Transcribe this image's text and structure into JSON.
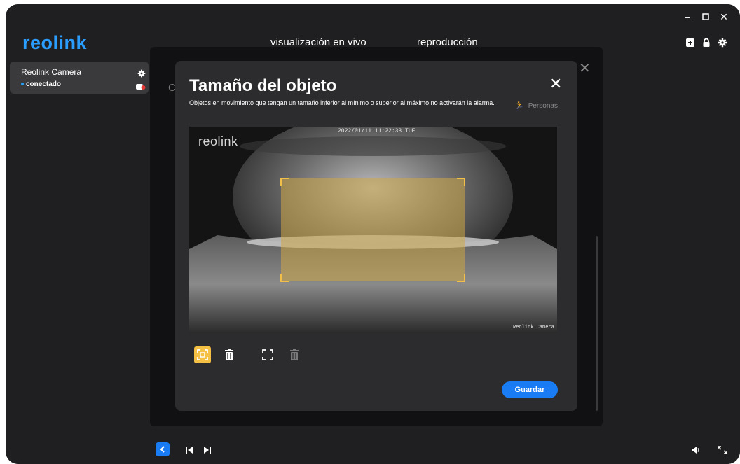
{
  "app": {
    "logo": "reolink",
    "nav_tabs": [
      "visualización en vivo",
      "reproducción"
    ],
    "window_controls": [
      "minimize-icon",
      "maximize-icon",
      "close-icon"
    ],
    "top_icons": [
      "add-device-icon",
      "lock-icon",
      "gear-icon"
    ],
    "accent_color": "#1a7cf5"
  },
  "sidebar": {
    "camera": {
      "name": "Reolink Camera",
      "status": "conectado"
    }
  },
  "settings_panel": {
    "partial_heading": "C"
  },
  "modal": {
    "title": "Tamaño del objeto",
    "description": "Objetos en movimiento que tengan un tamaño inferior al mínimo o superior al máximo no activarán la alarma.",
    "filter_label": "Personas",
    "feed": {
      "logo": "reolink",
      "timestamp": "2022/01/11 11:22:33 TUE",
      "camera_label": "Reolink Camera"
    },
    "tools": [
      "max-size-select-icon",
      "delete-max-icon",
      "min-size-select-icon",
      "delete-min-icon"
    ],
    "save_label": "Guardar"
  },
  "bottom_bar": {
    "icons": [
      "back-icon",
      "previous-icon",
      "next-icon",
      "volume-icon",
      "fullscreen-icon"
    ]
  }
}
